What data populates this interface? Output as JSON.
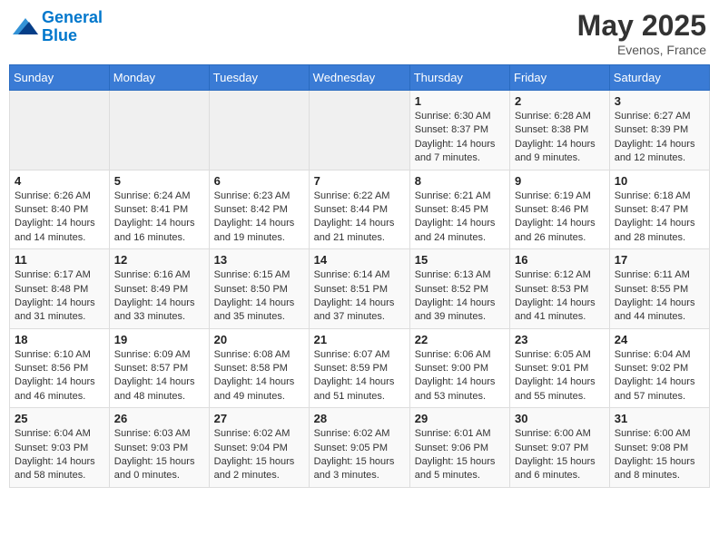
{
  "header": {
    "logo_line1": "General",
    "logo_line2": "Blue",
    "month_year": "May 2025",
    "location": "Evenos, France"
  },
  "weekdays": [
    "Sunday",
    "Monday",
    "Tuesday",
    "Wednesday",
    "Thursday",
    "Friday",
    "Saturday"
  ],
  "weeks": [
    [
      {
        "day": "",
        "empty": true
      },
      {
        "day": "",
        "empty": true
      },
      {
        "day": "",
        "empty": true
      },
      {
        "day": "",
        "empty": true
      },
      {
        "day": "1",
        "sunrise": "6:30 AM",
        "sunset": "8:37 PM",
        "daylight": "14 hours and 7 minutes."
      },
      {
        "day": "2",
        "sunrise": "6:28 AM",
        "sunset": "8:38 PM",
        "daylight": "14 hours and 9 minutes."
      },
      {
        "day": "3",
        "sunrise": "6:27 AM",
        "sunset": "8:39 PM",
        "daylight": "14 hours and 12 minutes."
      }
    ],
    [
      {
        "day": "4",
        "sunrise": "6:26 AM",
        "sunset": "8:40 PM",
        "daylight": "14 hours and 14 minutes."
      },
      {
        "day": "5",
        "sunrise": "6:24 AM",
        "sunset": "8:41 PM",
        "daylight": "14 hours and 16 minutes."
      },
      {
        "day": "6",
        "sunrise": "6:23 AM",
        "sunset": "8:42 PM",
        "daylight": "14 hours and 19 minutes."
      },
      {
        "day": "7",
        "sunrise": "6:22 AM",
        "sunset": "8:44 PM",
        "daylight": "14 hours and 21 minutes."
      },
      {
        "day": "8",
        "sunrise": "6:21 AM",
        "sunset": "8:45 PM",
        "daylight": "14 hours and 24 minutes."
      },
      {
        "day": "9",
        "sunrise": "6:19 AM",
        "sunset": "8:46 PM",
        "daylight": "14 hours and 26 minutes."
      },
      {
        "day": "10",
        "sunrise": "6:18 AM",
        "sunset": "8:47 PM",
        "daylight": "14 hours and 28 minutes."
      }
    ],
    [
      {
        "day": "11",
        "sunrise": "6:17 AM",
        "sunset": "8:48 PM",
        "daylight": "14 hours and 31 minutes."
      },
      {
        "day": "12",
        "sunrise": "6:16 AM",
        "sunset": "8:49 PM",
        "daylight": "14 hours and 33 minutes."
      },
      {
        "day": "13",
        "sunrise": "6:15 AM",
        "sunset": "8:50 PM",
        "daylight": "14 hours and 35 minutes."
      },
      {
        "day": "14",
        "sunrise": "6:14 AM",
        "sunset": "8:51 PM",
        "daylight": "14 hours and 37 minutes."
      },
      {
        "day": "15",
        "sunrise": "6:13 AM",
        "sunset": "8:52 PM",
        "daylight": "14 hours and 39 minutes."
      },
      {
        "day": "16",
        "sunrise": "6:12 AM",
        "sunset": "8:53 PM",
        "daylight": "14 hours and 41 minutes."
      },
      {
        "day": "17",
        "sunrise": "6:11 AM",
        "sunset": "8:55 PM",
        "daylight": "14 hours and 44 minutes."
      }
    ],
    [
      {
        "day": "18",
        "sunrise": "6:10 AM",
        "sunset": "8:56 PM",
        "daylight": "14 hours and 46 minutes."
      },
      {
        "day": "19",
        "sunrise": "6:09 AM",
        "sunset": "8:57 PM",
        "daylight": "14 hours and 48 minutes."
      },
      {
        "day": "20",
        "sunrise": "6:08 AM",
        "sunset": "8:58 PM",
        "daylight": "14 hours and 49 minutes."
      },
      {
        "day": "21",
        "sunrise": "6:07 AM",
        "sunset": "8:59 PM",
        "daylight": "14 hours and 51 minutes."
      },
      {
        "day": "22",
        "sunrise": "6:06 AM",
        "sunset": "9:00 PM",
        "daylight": "14 hours and 53 minutes."
      },
      {
        "day": "23",
        "sunrise": "6:05 AM",
        "sunset": "9:01 PM",
        "daylight": "14 hours and 55 minutes."
      },
      {
        "day": "24",
        "sunrise": "6:04 AM",
        "sunset": "9:02 PM",
        "daylight": "14 hours and 57 minutes."
      }
    ],
    [
      {
        "day": "25",
        "sunrise": "6:04 AM",
        "sunset": "9:03 PM",
        "daylight": "14 hours and 58 minutes."
      },
      {
        "day": "26",
        "sunrise": "6:03 AM",
        "sunset": "9:03 PM",
        "daylight": "15 hours and 0 minutes."
      },
      {
        "day": "27",
        "sunrise": "6:02 AM",
        "sunset": "9:04 PM",
        "daylight": "15 hours and 2 minutes."
      },
      {
        "day": "28",
        "sunrise": "6:02 AM",
        "sunset": "9:05 PM",
        "daylight": "15 hours and 3 minutes."
      },
      {
        "day": "29",
        "sunrise": "6:01 AM",
        "sunset": "9:06 PM",
        "daylight": "15 hours and 5 minutes."
      },
      {
        "day": "30",
        "sunrise": "6:00 AM",
        "sunset": "9:07 PM",
        "daylight": "15 hours and 6 minutes."
      },
      {
        "day": "31",
        "sunrise": "6:00 AM",
        "sunset": "9:08 PM",
        "daylight": "15 hours and 8 minutes."
      }
    ]
  ]
}
